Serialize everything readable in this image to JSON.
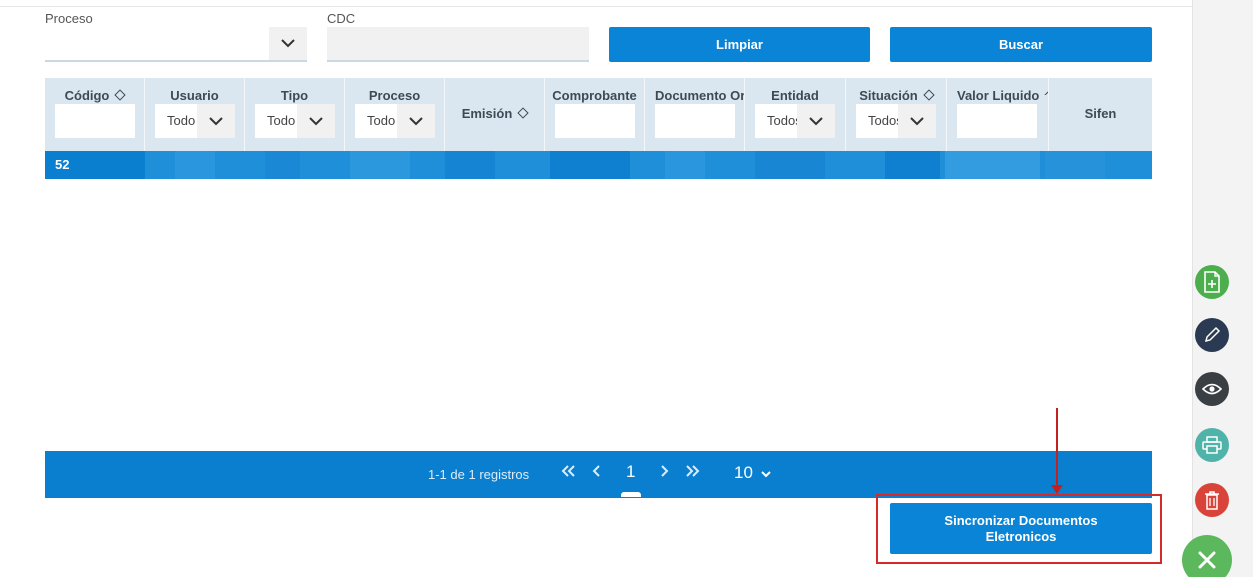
{
  "filters": {
    "proceso_label": "Proceso",
    "cdc_label": "CDC",
    "cdc_value": "",
    "limpiar_label": "Limpiar",
    "buscar_label": "Buscar"
  },
  "table": {
    "columns": [
      {
        "label": "Código",
        "sortable": true,
        "filter": "text"
      },
      {
        "label": "Usuario",
        "sortable": false,
        "filter": "select",
        "value": "Todo"
      },
      {
        "label": "Tipo",
        "sortable": false,
        "filter": "select",
        "value": "Todo"
      },
      {
        "label": "Proceso",
        "sortable": false,
        "filter": "select",
        "value": "Todo"
      },
      {
        "label": "Emisión",
        "sortable": true,
        "filter": "none"
      },
      {
        "label": "Comprobante",
        "sortable": false,
        "filter": "text"
      },
      {
        "label": "Documento Or",
        "sortable": false,
        "filter": "text"
      },
      {
        "label": "Entidad",
        "sortable": false,
        "filter": "select",
        "value": "Todos"
      },
      {
        "label": "Situación",
        "sortable": true,
        "filter": "select",
        "value": "Todos"
      },
      {
        "label": "Valor Liquido",
        "sortable": true,
        "filter": "text"
      },
      {
        "label": "Sifen",
        "sortable": false,
        "filter": "none"
      }
    ],
    "rows": [
      {
        "codigo": "52"
      }
    ]
  },
  "pager": {
    "count_text": "1-1 de 1 registros",
    "current_page": "1",
    "page_size": "10"
  },
  "sync_button": {
    "line1": "Sincronizar Documentos",
    "line2": "Eletronicos"
  },
  "colors": {
    "primary": "#0a84d6",
    "header_bg": "#dbe7f0",
    "row_selected": "#1f8fd9",
    "highlight": "#d42a2a",
    "fab_add": "#4cae4c",
    "fab_edit": "#2a3a52",
    "fab_view": "#3a3f44",
    "fab_print": "#4fb3a9",
    "fab_delete": "#d9443a",
    "fab_close": "#5cb85c"
  },
  "sidebar_icons": [
    "add-document-icon",
    "pencil-icon",
    "eye-icon",
    "printer-icon",
    "trash-icon",
    "close-icon"
  ]
}
